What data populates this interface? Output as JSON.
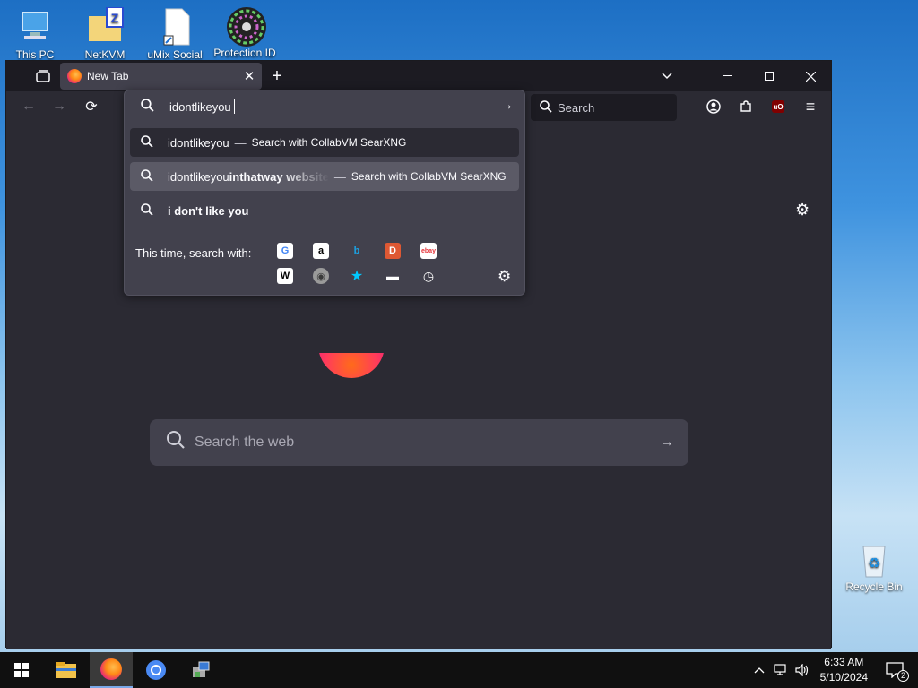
{
  "desktop": {
    "icons": [
      {
        "label": "This PC"
      },
      {
        "label": "NetKVM"
      },
      {
        "label": "uMix Social"
      },
      {
        "label": "Protection ID"
      },
      {
        "label": "Recycle Bin"
      }
    ]
  },
  "browser": {
    "tab": {
      "title": "New Tab",
      "close": "✕"
    },
    "tabbar": {
      "list_all_tabs": "⌄",
      "new_tab": "+",
      "minimize": "—",
      "maximize": "☐",
      "close": "✕"
    },
    "nav": {
      "back": "←",
      "forward": "→",
      "reload": "⟳"
    },
    "search_box": {
      "placeholder": "Search"
    },
    "toolbar": {
      "ublock_badge": "uO",
      "menu": "≡"
    },
    "urlbar": {
      "value": "idontlikeyou ",
      "suggestions": [
        {
          "query": "idontlikeyou",
          "completion": "",
          "separator": "—",
          "action": "Search with CollabVM SearXNG"
        },
        {
          "query": "idontlikeyou",
          "completion": "inthatway website",
          "separator": "—",
          "action": "Search with CollabVM SearXNG"
        },
        {
          "query": "i don't like you",
          "completion": "",
          "separator": "",
          "action": ""
        }
      ],
      "one_off_label": "This time, search with:",
      "engines": [
        {
          "icon": "google-icon",
          "glyph": "G",
          "color": "#4285f4",
          "bg": "#ffffff"
        },
        {
          "icon": "amazon-icon",
          "glyph": "a",
          "color": "#000000",
          "bg": "#ffffff"
        },
        {
          "icon": "bing-icon",
          "glyph": "b",
          "color": "#1ba1e2",
          "bg": "transparent"
        },
        {
          "icon": "duckduckgo-icon",
          "glyph": "D",
          "color": "#ffffff",
          "bg": "#de5833"
        },
        {
          "icon": "ebay-icon",
          "glyph": "ebay",
          "color": "#e53238",
          "bg": "#ffffff"
        },
        {
          "icon": "wikipedia-icon",
          "glyph": "W",
          "color": "#000000",
          "bg": "#ffffff"
        },
        {
          "icon": "searxng-icon",
          "glyph": "◉",
          "color": "#3a3a3a",
          "bg": "#9a9a9a"
        },
        {
          "icon": "bookmarks-icon",
          "glyph": "★",
          "color": "#00c8ff",
          "bg": "transparent"
        },
        {
          "icon": "tabs-icon",
          "glyph": "▬",
          "color": "#ffffff",
          "bg": "transparent"
        },
        {
          "icon": "history-icon",
          "glyph": "◷",
          "color": "#ffffff",
          "bg": "transparent"
        }
      ]
    },
    "content": {
      "search_placeholder": "Search the web"
    }
  },
  "taskbar": {
    "time": "6:33 AM",
    "date": "5/10/2024",
    "notifications": "2"
  }
}
